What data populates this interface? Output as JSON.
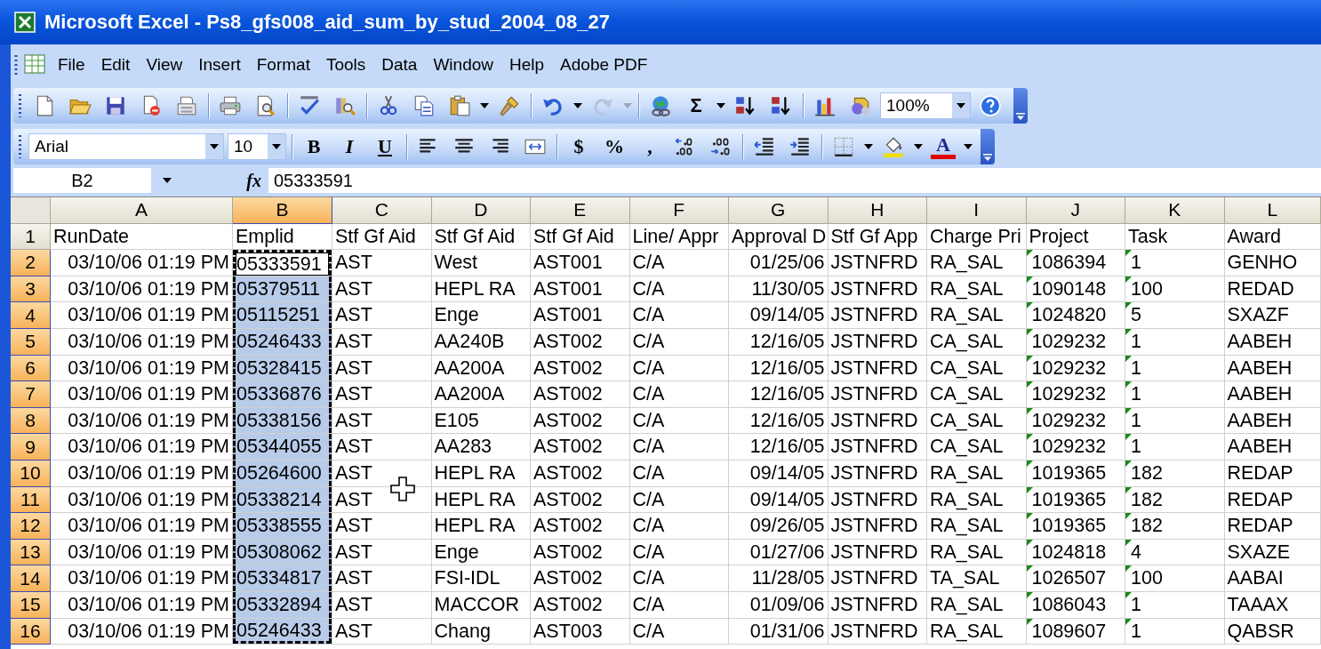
{
  "window": {
    "title": "Microsoft Excel - Ps8_gfs008_aid_sum_by_stud_2004_08_27"
  },
  "menu": [
    "File",
    "Edit",
    "View",
    "Insert",
    "Format",
    "Tools",
    "Data",
    "Window",
    "Help",
    "Adobe PDF"
  ],
  "standard_toolbar": {
    "sum_symbol": "Σ",
    "zoom": "100%"
  },
  "formatting_toolbar": {
    "font": "Arial",
    "size": "10",
    "text_buttons": [
      "B",
      "I",
      "U",
      "$",
      "%",
      ",",
      "A"
    ]
  },
  "formula_bar": {
    "name_box": "B2",
    "function_label": "fx",
    "value": "05333591"
  },
  "columns": [
    {
      "label": "A",
      "selected": false,
      "kind": "date"
    },
    {
      "label": "B",
      "selected": true,
      "kind": "text"
    },
    {
      "label": "C",
      "selected": false,
      "kind": "text"
    },
    {
      "label": "D",
      "selected": false,
      "kind": "text"
    },
    {
      "label": "E",
      "selected": false,
      "kind": "text"
    },
    {
      "label": "F",
      "selected": false,
      "kind": "text"
    },
    {
      "label": "G",
      "selected": false,
      "kind": "date"
    },
    {
      "label": "H",
      "selected": false,
      "kind": "text"
    },
    {
      "label": "I",
      "selected": false,
      "kind": "text"
    },
    {
      "label": "J",
      "selected": false,
      "kind": "number_as_text"
    },
    {
      "label": "K",
      "selected": false,
      "kind": "number_as_text"
    },
    {
      "label": "L",
      "selected": false,
      "kind": "text"
    }
  ],
  "rows": [
    {
      "header": "1",
      "kind": "labels",
      "selected": false,
      "active": false,
      "cells": [
        "RunDate",
        "Emplid",
        "Stf Gf Aid",
        "Stf Gf Aid",
        "Stf Gf Aid",
        "Line/ Appr",
        "Approval D",
        "Stf Gf App",
        "Charge Pri",
        "Project",
        "Task",
        "Award"
      ]
    },
    {
      "header": "2",
      "kind": "data",
      "selected": true,
      "active": true,
      "cells": [
        "03/10/06 01:19 PM",
        "05333591",
        "AST",
        "West",
        "AST001",
        "C/A",
        "01/25/06",
        "JSTNFRD",
        "RA_SAL",
        "1086394",
        "1",
        "GENHO"
      ]
    },
    {
      "header": "3",
      "kind": "data",
      "selected": true,
      "active": false,
      "cells": [
        "03/10/06 01:19 PM",
        "05379511",
        "AST",
        "HEPL RA",
        "AST001",
        "C/A",
        "11/30/05",
        "JSTNFRD",
        "RA_SAL",
        "1090148",
        "100",
        "REDAD"
      ]
    },
    {
      "header": "4",
      "kind": "data",
      "selected": true,
      "active": false,
      "cells": [
        "03/10/06 01:19 PM",
        "05115251",
        "AST",
        "Enge",
        "AST001",
        "C/A",
        "09/14/05",
        "JSTNFRD",
        "RA_SAL",
        "1024820",
        "5",
        "SXAZF"
      ]
    },
    {
      "header": "5",
      "kind": "data",
      "selected": true,
      "active": false,
      "cells": [
        "03/10/06 01:19 PM",
        "05246433",
        "AST",
        "AA240B",
        "AST002",
        "C/A",
        "12/16/05",
        "JSTNFRD",
        "CA_SAL",
        "1029232",
        "1",
        "AABEH"
      ]
    },
    {
      "header": "6",
      "kind": "data",
      "selected": true,
      "active": false,
      "cells": [
        "03/10/06 01:19 PM",
        "05328415",
        "AST",
        "AA200A",
        "AST002",
        "C/A",
        "12/16/05",
        "JSTNFRD",
        "CA_SAL",
        "1029232",
        "1",
        "AABEH"
      ]
    },
    {
      "header": "7",
      "kind": "data",
      "selected": true,
      "active": false,
      "cells": [
        "03/10/06 01:19 PM",
        "05336876",
        "AST",
        "AA200A",
        "AST002",
        "C/A",
        "12/16/05",
        "JSTNFRD",
        "CA_SAL",
        "1029232",
        "1",
        "AABEH"
      ]
    },
    {
      "header": "8",
      "kind": "data",
      "selected": true,
      "active": false,
      "cells": [
        "03/10/06 01:19 PM",
        "05338156",
        "AST",
        "E105",
        "AST002",
        "C/A",
        "12/16/05",
        "JSTNFRD",
        "CA_SAL",
        "1029232",
        "1",
        "AABEH"
      ]
    },
    {
      "header": "9",
      "kind": "data",
      "selected": true,
      "active": false,
      "cells": [
        "03/10/06 01:19 PM",
        "05344055",
        "AST",
        "AA283",
        "AST002",
        "C/A",
        "12/16/05",
        "JSTNFRD",
        "CA_SAL",
        "1029232",
        "1",
        "AABEH"
      ]
    },
    {
      "header": "10",
      "kind": "data",
      "selected": true,
      "active": false,
      "cells": [
        "03/10/06 01:19 PM",
        "05264600",
        "AST",
        "HEPL RA",
        "AST002",
        "C/A",
        "09/14/05",
        "JSTNFRD",
        "RA_SAL",
        "1019365",
        "182",
        "REDAP"
      ]
    },
    {
      "header": "11",
      "kind": "data",
      "selected": true,
      "active": false,
      "cells": [
        "03/10/06 01:19 PM",
        "05338214",
        "AST",
        "HEPL RA",
        "AST002",
        "C/A",
        "09/14/05",
        "JSTNFRD",
        "RA_SAL",
        "1019365",
        "182",
        "REDAP"
      ]
    },
    {
      "header": "12",
      "kind": "data",
      "selected": true,
      "active": false,
      "cells": [
        "03/10/06 01:19 PM",
        "05338555",
        "AST",
        "HEPL RA",
        "AST002",
        "C/A",
        "09/26/05",
        "JSTNFRD",
        "RA_SAL",
        "1019365",
        "182",
        "REDAP"
      ]
    },
    {
      "header": "13",
      "kind": "data",
      "selected": true,
      "active": false,
      "cells": [
        "03/10/06 01:19 PM",
        "05308062",
        "AST",
        "Enge",
        "AST002",
        "C/A",
        "01/27/06",
        "JSTNFRD",
        "RA_SAL",
        "1024818",
        "4",
        "SXAZE"
      ]
    },
    {
      "header": "14",
      "kind": "data",
      "selected": true,
      "active": false,
      "cells": [
        "03/10/06 01:19 PM",
        "05334817",
        "AST",
        "FSI-IDL",
        "AST002",
        "C/A",
        "11/28/05",
        "JSTNFRD",
        "TA_SAL",
        "1026507",
        "100",
        "AABAI"
      ]
    },
    {
      "header": "15",
      "kind": "data",
      "selected": true,
      "active": false,
      "cells": [
        "03/10/06 01:19 PM",
        "05332894",
        "AST",
        "MACCOR",
        "AST002",
        "C/A",
        "01/09/06",
        "JSTNFRD",
        "RA_SAL",
        "1086043",
        "1",
        "TAAAX"
      ]
    },
    {
      "header": "16",
      "kind": "data",
      "selected": true,
      "active": false,
      "cells": [
        "03/10/06 01:19 PM",
        "05246433",
        "AST",
        "Chang",
        "AST003",
        "C/A",
        "01/31/06",
        "JSTNFRD",
        "RA_SAL",
        "1089607",
        "1",
        "QABSR"
      ]
    }
  ]
}
